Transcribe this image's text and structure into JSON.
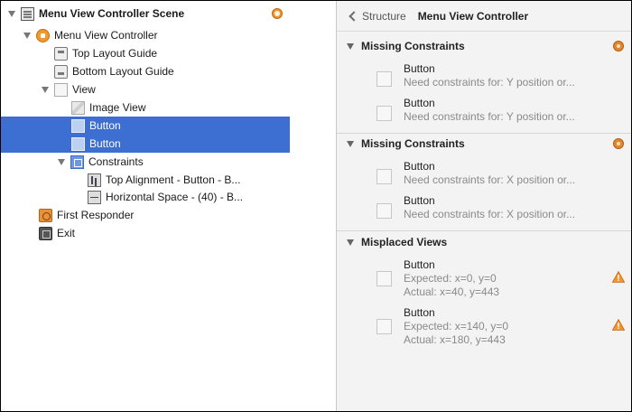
{
  "outline": {
    "scene_title": "Menu View Controller Scene",
    "items": [
      {
        "label": "Menu View Controller Scene"
      },
      {
        "label": "Menu View Controller"
      },
      {
        "label": "Top Layout Guide"
      },
      {
        "label": "Bottom Layout Guide"
      },
      {
        "label": "View"
      },
      {
        "label": "Image View"
      },
      {
        "label": "Button"
      },
      {
        "label": "Button"
      },
      {
        "label": "Constraints"
      },
      {
        "label": "Top Alignment - Button - B..."
      },
      {
        "label": "Horizontal Space - (40) - B..."
      },
      {
        "label": "First Responder"
      },
      {
        "label": "Exit"
      }
    ]
  },
  "issues": {
    "breadcrumb": {
      "back_label": "Structure",
      "title": "Menu View Controller"
    },
    "sections": [
      {
        "title": "Missing Constraints",
        "items": [
          {
            "title": "Button",
            "lines": [
              "Need constraints for: Y position or..."
            ]
          },
          {
            "title": "Button",
            "lines": [
              "Need constraints for: Y position or..."
            ]
          }
        ]
      },
      {
        "title": "Missing Constraints",
        "items": [
          {
            "title": "Button",
            "lines": [
              "Need constraints for: X position or..."
            ]
          },
          {
            "title": "Button",
            "lines": [
              "Need constraints for: X position or..."
            ]
          }
        ]
      },
      {
        "title": "Misplaced Views",
        "items": [
          {
            "title": "Button",
            "lines": [
              "Expected: x=0, y=0",
              "Actual: x=40, y=443"
            ]
          },
          {
            "title": "Button",
            "lines": [
              "Expected: x=140, y=0",
              "Actual: x=180, y=443"
            ]
          }
        ]
      }
    ]
  },
  "colors": {
    "selection": "#3d6fd3",
    "warning": "#e6862c",
    "panel_bg": "#f3f3f3"
  },
  "icons": {
    "scene": "storyboard-scene-icon",
    "view_controller": "view-controller-icon",
    "layout_guide": "layout-guide-icon",
    "view": "view-icon",
    "image_view": "image-view-icon",
    "button": "button-icon",
    "constraints": "constraints-icon",
    "first_responder": "first-responder-icon",
    "exit": "exit-icon",
    "warning": "warning-triangle-icon"
  }
}
